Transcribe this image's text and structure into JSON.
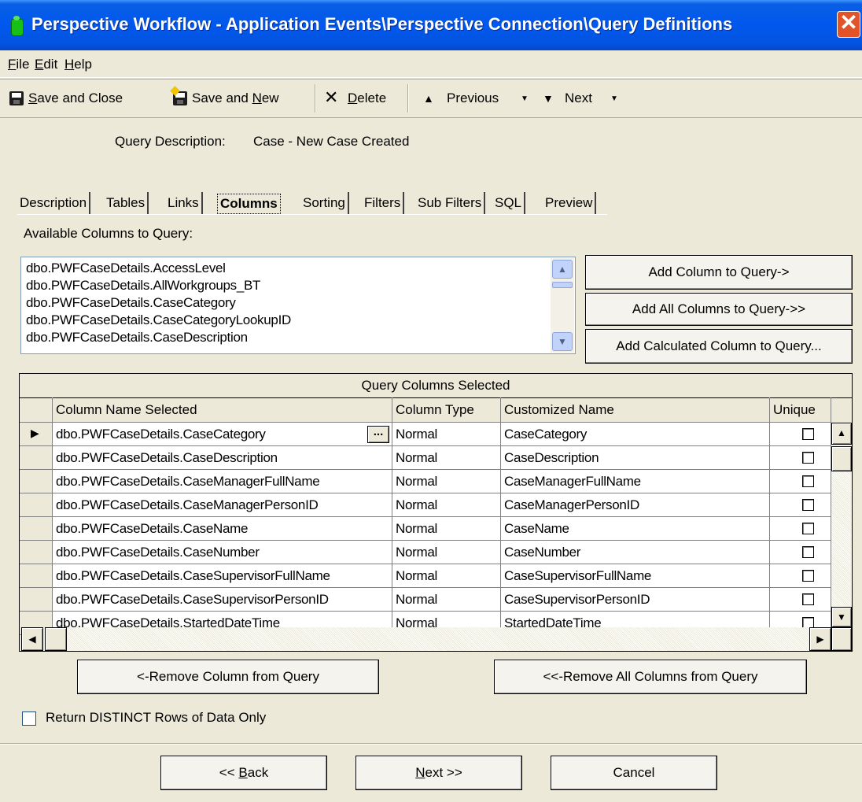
{
  "window": {
    "title": "Perspective Workflow - Application Events\\Perspective Connection\\Query Definitions",
    "close_glyph": "✕"
  },
  "menu": [
    {
      "label_ul": "F",
      "label_rest": "ile"
    },
    {
      "label_ul": "E",
      "label_rest": "dit"
    },
    {
      "label_ul": "H",
      "label_rest": "elp"
    }
  ],
  "toolbar": {
    "save_close_ul": "S",
    "save_close_rest": "ave and Close",
    "save_new_pre": "Save and ",
    "save_new_ul": "N",
    "save_new_rest": "ew",
    "delete_ul": "D",
    "delete_rest": "elete",
    "previous": "Previous",
    "next": "Next"
  },
  "query": {
    "label": "Query Description:",
    "value": "Case - New Case Created"
  },
  "tabs": [
    "Description",
    "Tables",
    "Links",
    "Columns",
    "Sorting",
    "Filters",
    "Sub Filters",
    "SQL",
    "Preview"
  ],
  "available": {
    "label": "Available Columns to Query:",
    "items": [
      "dbo.PWFCaseDetails.AccessLevel",
      "dbo.PWFCaseDetails.AllWorkgroups_BT",
      "dbo.PWFCaseDetails.CaseCategory",
      "dbo.PWFCaseDetails.CaseCategoryLookupID",
      "dbo.PWFCaseDetails.CaseDescription"
    ]
  },
  "buttons": {
    "add_column": "Add Column to Query->",
    "add_all": "Add All Columns to Query->>",
    "add_calc": "Add Calculated Column to Query...",
    "remove_column": "<-Remove Column from Query",
    "remove_all": "<<-Remove All Columns from Query",
    "ellipsis": "...",
    "back_pre": "<< ",
    "back_ul": "B",
    "back_rest": "ack",
    "next_ul": "N",
    "next_rest": "ext >>",
    "cancel": "Cancel"
  },
  "grid": {
    "caption": "Query Columns Selected",
    "headers": [
      "Column Name Selected",
      "Column Type",
      "Customized Name",
      "Unique"
    ],
    "rows": [
      {
        "name": "dbo.PWFCaseDetails.CaseCategory",
        "type": "Normal",
        "custom": "CaseCategory",
        "unique": false
      },
      {
        "name": "dbo.PWFCaseDetails.CaseDescription",
        "type": "Normal",
        "custom": "CaseDescription",
        "unique": false
      },
      {
        "name": "dbo.PWFCaseDetails.CaseManagerFullName",
        "type": "Normal",
        "custom": "CaseManagerFullName",
        "unique": false
      },
      {
        "name": "dbo.PWFCaseDetails.CaseManagerPersonID",
        "type": "Normal",
        "custom": "CaseManagerPersonID",
        "unique": false
      },
      {
        "name": "dbo.PWFCaseDetails.CaseName",
        "type": "Normal",
        "custom": "CaseName",
        "unique": false
      },
      {
        "name": "dbo.PWFCaseDetails.CaseNumber",
        "type": "Normal",
        "custom": "CaseNumber",
        "unique": false
      },
      {
        "name": "dbo.PWFCaseDetails.CaseSupervisorFullName",
        "type": "Normal",
        "custom": "CaseSupervisorFullName",
        "unique": false
      },
      {
        "name": "dbo.PWFCaseDetails.CaseSupervisorPersonID",
        "type": "Normal",
        "custom": "CaseSupervisorPersonID",
        "unique": false
      },
      {
        "name": "dbo.PWFCaseDetails.StartedDateTime",
        "type": "Normal",
        "custom": "StartedDateTime",
        "unique": false
      }
    ]
  },
  "distinct": {
    "label": "Return DISTINCT Rows of Data Only",
    "checked": false
  },
  "icons": [
    "app-icon",
    "save-icon",
    "save-new-icon",
    "delete-icon",
    "up-arrow-icon",
    "down-arrow-icon",
    "dropdown-icon",
    "row-pointer-icon",
    "scroll-up-icon",
    "scroll-down-icon",
    "scroll-left-icon",
    "scroll-right-icon"
  ],
  "colors": {
    "titlebar": "#0058EE",
    "face": "#ECE9D8",
    "close": "#E2532A"
  }
}
